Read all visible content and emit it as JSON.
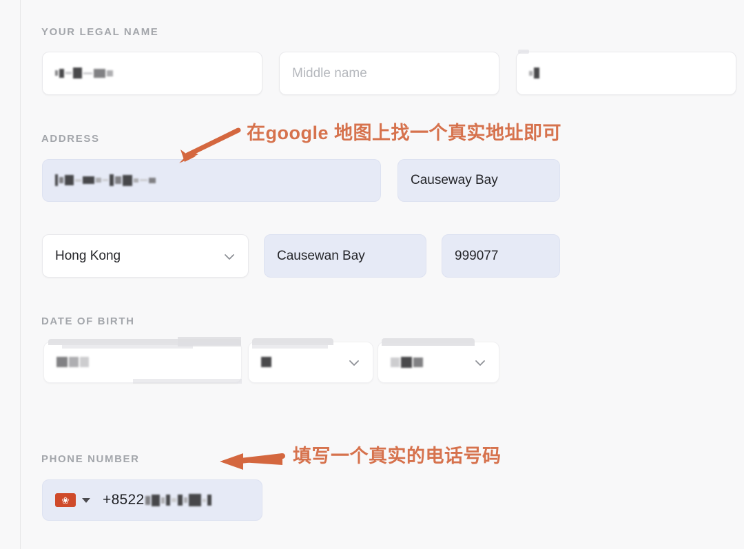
{
  "form": {
    "sections": [
      {
        "id": "legal-name",
        "label": "YOUR LEGAL NAME"
      },
      {
        "id": "address",
        "label": "ADDRESS"
      },
      {
        "id": "date-of-birth",
        "label": "DATE OF BIRTH"
      },
      {
        "id": "phone-number",
        "label": "PHONE NUMBER"
      }
    ],
    "fields": {
      "first_name": {
        "value": "",
        "redacted": true,
        "placeholder": ""
      },
      "middle_name": {
        "value": "",
        "placeholder": "Middle name"
      },
      "last_name": {
        "value": "",
        "redacted": true,
        "placeholder": ""
      },
      "street_address": {
        "value": "",
        "redacted": true,
        "autofill": true
      },
      "apt_suite": {
        "value": "Causeway Bay",
        "autofill": true
      },
      "country": {
        "value": "Hong Kong",
        "type": "select"
      },
      "city": {
        "value": "Causewan Bay",
        "autofill": true
      },
      "postal_code": {
        "value": "999077",
        "autofill": true
      },
      "dob_year": {
        "value": "",
        "redacted": true
      },
      "dob_day": {
        "value": "",
        "redacted": true,
        "type": "select"
      },
      "dob_month": {
        "value": "",
        "redacted": true,
        "type": "select"
      },
      "phone": {
        "country_flag": "hong-kong-flag",
        "dial_prefix": "+8522",
        "value_redacted": true
      }
    }
  },
  "annotations": [
    {
      "id": "address-note",
      "text": "在google 地图上找一个真实地址即可",
      "arrow": "arrow-diagonal-down-left",
      "color": "#d4673f"
    },
    {
      "id": "phone-note",
      "text": "填写一个真实的电话号码",
      "arrow": "arrow-left",
      "color": "#d4673f"
    }
  ],
  "colors": {
    "accent_annotation": "#d4673f",
    "autofill_background": "#e6eaf6",
    "field_background": "#ffffff",
    "label_text": "#a3a6ab",
    "page_background": "#f8f8f9",
    "flag_red": "#cf4a2a"
  }
}
